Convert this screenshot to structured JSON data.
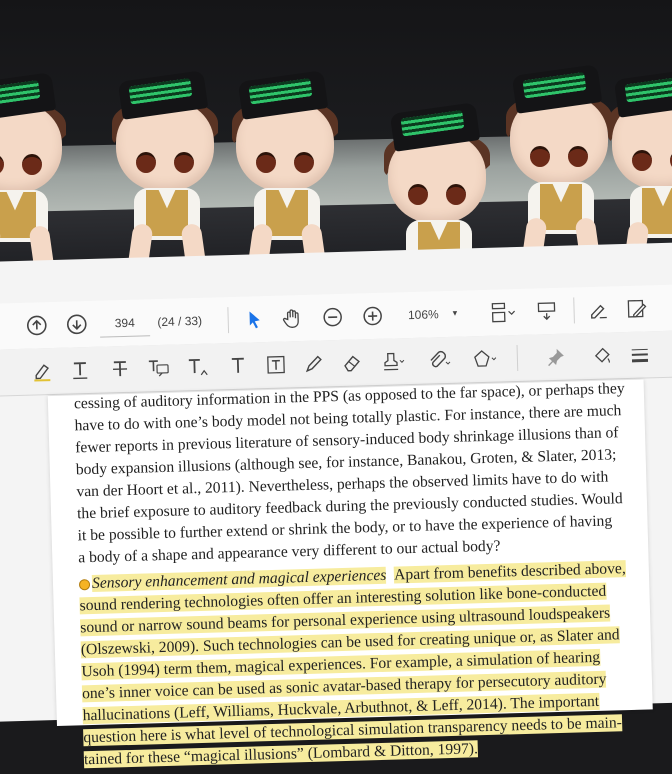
{
  "toolbar": {
    "current_page_input": "394",
    "page_position": "(24 / 33)",
    "zoom_level": "106%"
  },
  "document": {
    "paragraph_1": [
      "cessing of auditory information in the PPS (as opposed to the far space), or perhaps they",
      "have to do with one’s body model not being totally plastic. For instance, there are much",
      "fewer reports in previous literature of sensory-induced body shrinkage illusions than of",
      "body expansion illusions (although see, for instance, Banakou, Groten, & Slater, 2013;",
      "van der Hoort et al., 2011). Nevertheless, perhaps the observed limits have to do with",
      "the brief exposure to auditory feedback during the previously conducted studies. Would",
      "it be possible to further extend or shrink the body, or to have the experience of having",
      "a body of a shape and appearance very different to our actual body?"
    ],
    "section_heading": "Sensory enhancement and magical experiences",
    "paragraph_2_first": "Apart from benefits described above,",
    "paragraph_2": [
      "sound rendering technologies often offer an interesting solution like bone-conducted",
      "sound or narrow sound beams for personal experience using ultrasound loudspeakers",
      "(Olszewski, 2009). Such technologies can be used for creating unique or, as Slater and",
      "Usoh (1994) term them, magical experiences. For example, a simulation of hearing",
      "one’s inner voice can be used as sonic avatar-based therapy for persecutory auditory",
      "hallucinations (Leff, Williams, Huckvale, Arbuthnot, & Leff, 2014). The important",
      "question here is what level of technological simulation transparency needs to be main-",
      "tained for these “magical illusions” (Lombard & Ditton, 1997)."
    ]
  },
  "colors": {
    "highlight": "#f7ec9e",
    "select_tool": "#1a73e8",
    "hat_stripe": "#2fc36a",
    "hair": "#5a3424"
  },
  "icons": [
    "previous-page-icon",
    "next-page-icon",
    "select-tool-icon",
    "hand-tool-icon",
    "zoom-out-icon",
    "zoom-in-icon",
    "page-layout-icon",
    "scroll-mode-icon",
    "sign-icon",
    "edit-icon",
    "highlight-icon",
    "underline-text-icon",
    "strikethrough-text-icon",
    "replace-text-icon",
    "insert-text-icon",
    "text-box-icon",
    "text-callout-icon",
    "pencil-icon",
    "eraser-icon",
    "stamp-icon",
    "attach-icon",
    "shapes-icon",
    "pin-icon",
    "fill-color-icon",
    "line-weight-icon"
  ]
}
